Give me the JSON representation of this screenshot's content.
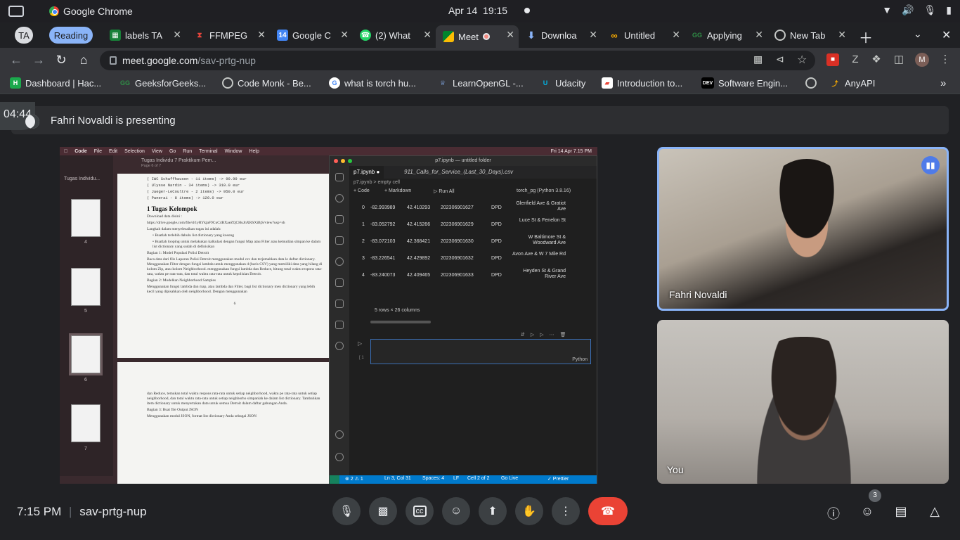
{
  "os": {
    "app_name": "Google Chrome",
    "date": "Apr 14",
    "time": "19:15"
  },
  "tabs": [
    {
      "label": "TA",
      "kind": "group-chip"
    },
    {
      "label": "Reading",
      "kind": "group-chip"
    },
    {
      "label": "labels TA",
      "icon": "sheets-icon"
    },
    {
      "label": "FFMPEG",
      "icon": "ffmpeg-icon"
    },
    {
      "label": "Google C",
      "icon": "calendar-icon",
      "icon_text": "14"
    },
    {
      "label": "(2) What",
      "icon": "whatsapp-icon"
    },
    {
      "label": "Meet",
      "icon": "meet-icon",
      "active": true
    },
    {
      "label": "Downloa",
      "icon": "download-icon"
    },
    {
      "label": "Untitled",
      "icon": "colab-icon"
    },
    {
      "label": "Applying",
      "icon": "gfg-icon"
    },
    {
      "label": "New Tab",
      "icon": "chrome-icon"
    }
  ],
  "address_bar": {
    "host": "meet.google.com",
    "path": "/sav-prtg-nup"
  },
  "profile_initial": "M",
  "bookmarks": [
    {
      "label": "Dashboard | Hac...",
      "icon_text": "H"
    },
    {
      "label": "GeeksforGeeks...",
      "icon_text": "GG"
    },
    {
      "label": "Code Monk - Be...",
      "icon_text": ""
    },
    {
      "label": "what is torch hu...",
      "icon_text": "G"
    },
    {
      "label": "LearnOpenGL -...",
      "icon_text": ""
    },
    {
      "label": "Udacity",
      "icon_text": "U"
    },
    {
      "label": "Introduction to...",
      "icon_text": ""
    },
    {
      "label": "Software Engin...",
      "icon_text": "DEV"
    },
    {
      "label": "",
      "icon_text": ""
    },
    {
      "label": "AnyAPI",
      "icon_text": ""
    }
  ],
  "meet": {
    "timer": "04:44",
    "presenting_text": "Fahri Novaldi is presenting",
    "meeting_time": "7:15 PM",
    "meeting_code": "sav-prtg-nup",
    "participants_count": "3",
    "tiles": [
      {
        "name": "Fahri Novaldi",
        "speaking": true
      },
      {
        "name": "You",
        "speaking": false
      }
    ]
  },
  "shared_screen": {
    "mac_menu": [
      "Code",
      "File",
      "Edit",
      "Selection",
      "View",
      "Go",
      "Run",
      "Terminal",
      "Window",
      "Help"
    ],
    "mac_clock": "Fri 14 Apr  7.15 PM",
    "pdf": {
      "title": "Tugas Individu 7 Praktikum Pem...",
      "subtitle": "Page 6 of 7",
      "sidebar_title": "Tugas Individu...",
      "thumb_pages": [
        "4",
        "5",
        "6",
        "7"
      ],
      "code_lines": [
        "( IWC Schaffhausen - 11 items)  ->  99.99 eur",
        "( Ulysse Nardin - 34 items)  ->  310.0 eur",
        "( Jaeger-LeCoultre - 2 items)  ->  950.0 eur",
        "( Panerai - 8 items)  ->  120.0 eur"
      ],
      "heading": "1   Tugas Kelompok",
      "para1": "Download data disini :",
      "link": "https://drive.google.com/file/d/1yRYkjaF9CuC4RXaeZQCHuJnXRSXiBjS/view?usp=sh",
      "para2": "Langkah dalam menyelesaikan tugas ini adalah:",
      "bullets": [
        "Buatlah terlebih dahulu list dictionary yang kosong",
        "Buatlah looping untuk melakukan kalkulasi dengan fungsi Map atau Filter atau kemudian simpan ke dalam list dictionary yang sudah di definisikan"
      ],
      "section1": "Bagian 1: Model Populasi Polisi Detroit",
      "para3": "Baca data dari file Laporan Polisi Detroit menggunakan modul csv dan terjemahkan data le daftar dictionary.  Menggunakan Filter dengan fungsi lambda untuk menggunakan d (baris CSV) yang memiliki data yang hilang di kolom Zip, atau kolom Neighborhood.  menggunakan fungsi lambda dan Reduce, hitung total waktu respons rata-rata, waktu pe rata-rata, dan total waktu rata-rata untuk kepolisian Detroit.",
      "section2": "Bagian 2: Modelkan Neighborhood Samples",
      "para4": "Menggunakan fungsi lambda dan map, atau lambda dan Filter, bagi list dictionary men dictionary yang lebih kecil yang dipisahkan oleh neighborhood.  Dengan menggunakan",
      "page_number": "6",
      "para5": "dan Reduce, temukan total waktu respons rata-rata untuk setiap neighborhood, waktu pe rata-rata untuk setiap neighborhood, dan total waktu rata-rata untuk setiap neighborho simpanlah ke dalam list dictionary. Tambahkan item dictionary untuk menyertakan data untuk semua Detroit dalam daftar gabungan Anda.",
      "section3": "Bagian 3: Buat file Output JSON",
      "para6": "Menggunakan modul JSON, format list dictionary Anda sebagai JSON"
    },
    "vscode": {
      "window_title": "p7.ipynb — untitled folder",
      "tab1": "p7.ipynb",
      "tab2": "911_Calls_for_Service_(Last_30_Days).csv",
      "breadcrumb": "p7.ipynb > empty cell",
      "btn_code": "+ Code",
      "btn_markdown": "+ Markdown",
      "btn_runall": "Run All",
      "kernel": "torch_pg (Python 3.8.16)",
      "rows": [
        {
          "idx": "0",
          "x": "-82.993989",
          "y": "42.410293",
          "id": "202306901627",
          "agency": "DPD",
          "location": "Glenfield Ave & Gratiot Ave"
        },
        {
          "idx": "1",
          "x": "-83.052792",
          "y": "42.415266",
          "id": "202306901629",
          "agency": "DPD",
          "location": "Luce St & Fenelon St"
        },
        {
          "idx": "2",
          "x": "-83.072103",
          "y": "42.368421",
          "id": "202306901630",
          "agency": "DPD",
          "location": "W Baltimore St & Woodward Ave"
        },
        {
          "idx": "3",
          "x": "-83.226541",
          "y": "42.429892",
          "id": "202306901632",
          "agency": "DPD",
          "location": "Avon Ave & W 7 Mile Rd"
        },
        {
          "idx": "4",
          "x": "-83.240073",
          "y": "42.409465",
          "id": "202306901633",
          "agency": "DPD",
          "location": "Heyden St & Grand River Ave"
        }
      ],
      "shape": "5 rows × 26 columns",
      "cell_lang": "Python",
      "cell_line": "1",
      "status": {
        "errors": "⊗ 2 ⚠ 1",
        "position": "Ln 3, Col 31",
        "spaces": "Spaces: 4",
        "eol": "LF",
        "cell": "Cell 2 of 2",
        "golive": "Go Live",
        "prettier": "✓ Prettier"
      }
    }
  }
}
